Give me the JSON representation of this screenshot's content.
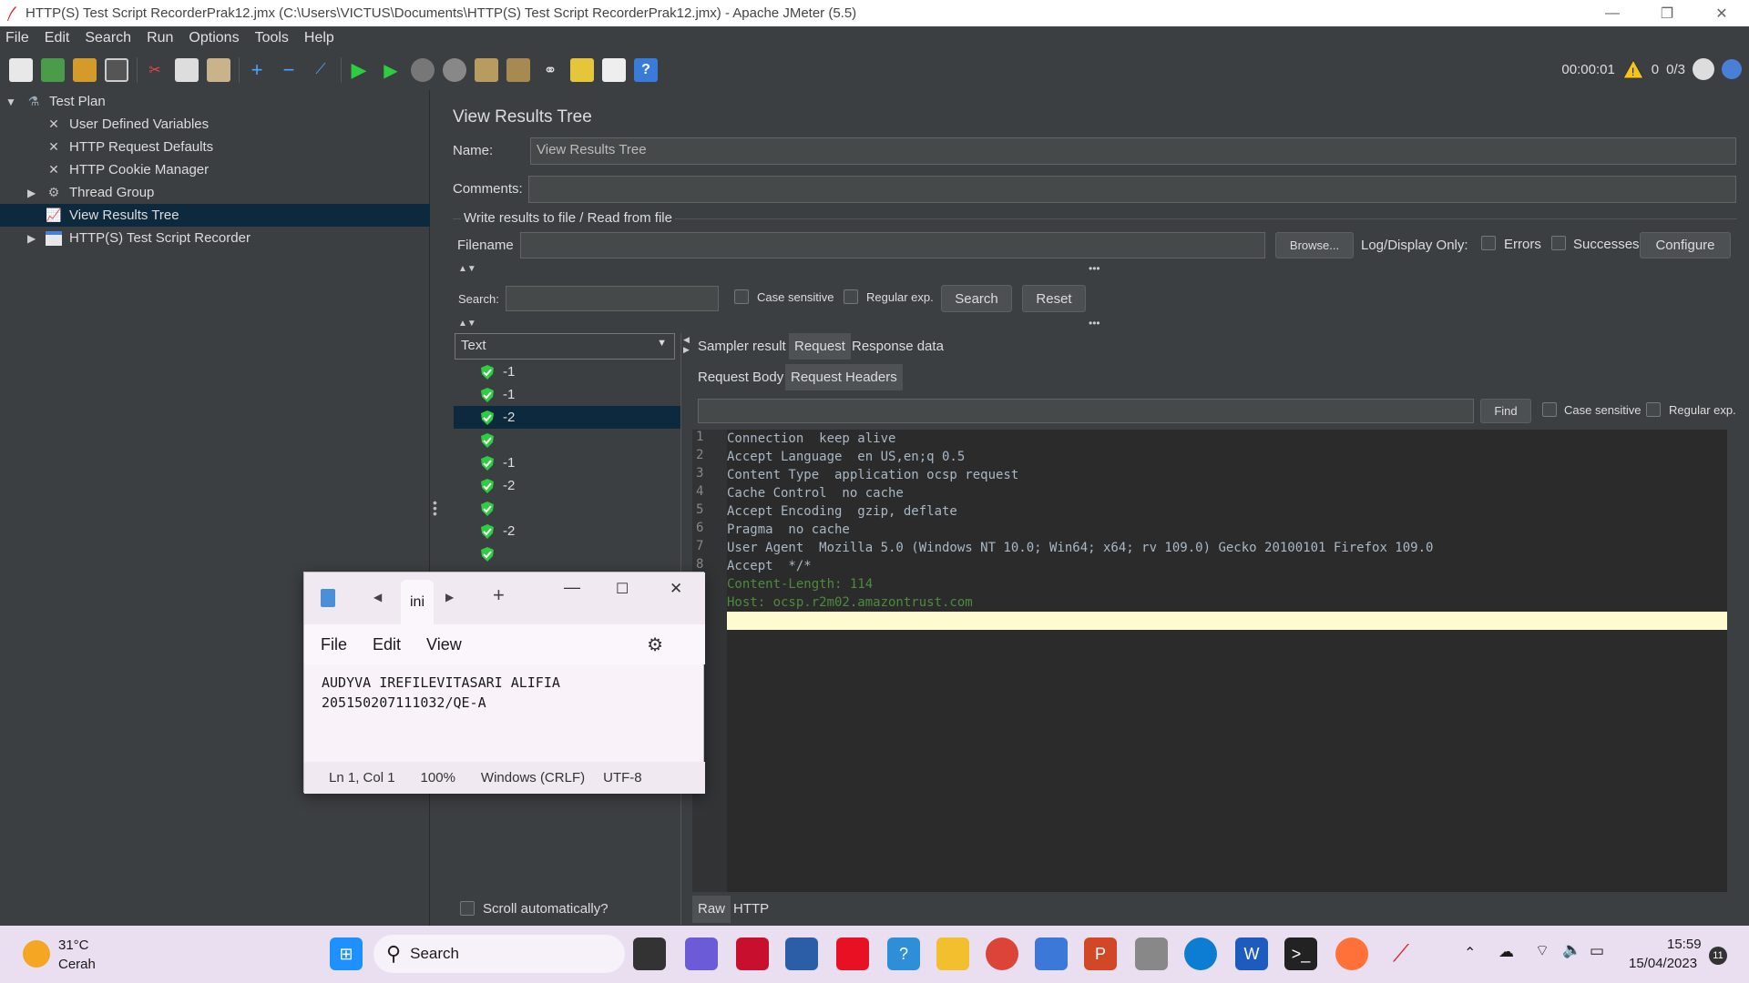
{
  "window": {
    "title": "HTTP(S) Test Script RecorderPrak12.jmx (C:\\Users\\VICTUS\\Documents\\HTTP(S) Test Script RecorderPrak12.jmx) - Apache JMeter (5.5)"
  },
  "menu": [
    "File",
    "Edit",
    "Search",
    "Run",
    "Options",
    "Tools",
    "Help"
  ],
  "status": {
    "elapsed": "00:00:01",
    "warnings": "0",
    "threads": "0/3"
  },
  "tree": {
    "root": "Test Plan",
    "items": [
      "User Defined Variables",
      "HTTP Request Defaults",
      "HTTP Cookie Manager",
      "Thread Group",
      "View Results Tree",
      "HTTP(S) Test Script Recorder"
    ]
  },
  "panel": {
    "heading": "View Results Tree",
    "name_label": "Name:",
    "name_value": "View Results Tree",
    "comments_label": "Comments:",
    "file_section": "Write results to file / Read from file",
    "filename_label": "Filename",
    "browse": "Browse...",
    "log_display": "Log/Display Only:",
    "errors": "Errors",
    "successes": "Successes",
    "configure": "Configure",
    "search_label": "Search:",
    "case_sensitive": "Case sensitive",
    "regular_exp": "Regular exp.",
    "search_btn": "Search",
    "reset_btn": "Reset",
    "renderer": "Text",
    "scroll_auto": "Scroll automatically?"
  },
  "results": [
    "-1",
    "-1",
    "-2",
    "",
    "-1",
    "-2",
    "",
    "-2",
    ""
  ],
  "tabs": {
    "sampler": "Sampler result",
    "request": "Request",
    "response": "Response data"
  },
  "subtabs": {
    "body": "Request Body",
    "headers": "Request Headers"
  },
  "find": {
    "button": "Find",
    "case_sensitive": "Case sensitive",
    "regular_exp": "Regular exp."
  },
  "lines": [
    {
      "n": "1",
      "text": "Connection  keep alive"
    },
    {
      "n": "2",
      "text": "Accept Language  en US,en;q 0.5"
    },
    {
      "n": "3",
      "text": "Content Type  application ocsp request"
    },
    {
      "n": "4",
      "text": "Cache Control  no cache"
    },
    {
      "n": "5",
      "text": "Accept Encoding  gzip, deflate"
    },
    {
      "n": "6",
      "text": "Pragma  no cache"
    },
    {
      "n": "7",
      "text": "User Agent  Mozilla 5.0 (Windows NT 10.0; Win64; x64; rv 109.0) Gecko 20100101 Firefox 109.0"
    },
    {
      "n": "8",
      "text": "Accept  */*"
    },
    {
      "n": "9",
      "text": "Content-Length: 114"
    },
    {
      "n": "0",
      "text": "Host: ocsp.r2m02.amazontrust.com"
    },
    {
      "n": "1",
      "text": ""
    }
  ],
  "bottom_tabs": {
    "raw": "Raw",
    "http": "HTTP"
  },
  "notepad": {
    "tab": "ini",
    "menu": [
      "File",
      "Edit",
      "View"
    ],
    "line1": "AUDYVA IREFILEVITASARI ALIFIA",
    "line2": "205150207111032/QE-A",
    "status": [
      "Ln 1, Col 1",
      "100%",
      "Windows (CRLF)",
      "UTF-8"
    ]
  },
  "taskbar": {
    "temp": "31°C",
    "weather": "Cerah",
    "search": "Search",
    "time": "15:59",
    "date": "15/04/2023",
    "badge": "11"
  }
}
